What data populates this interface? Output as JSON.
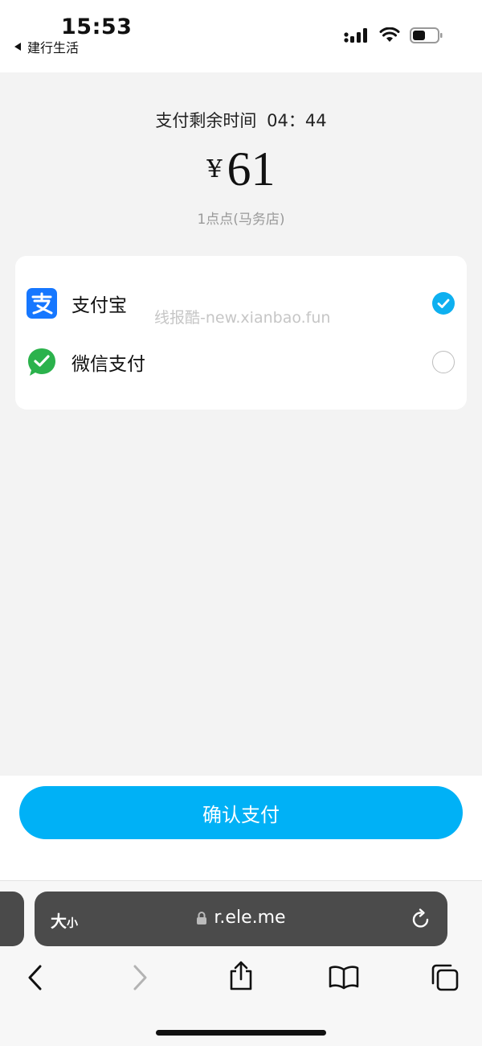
{
  "status_bar": {
    "time": "15:53",
    "back_app": "建行生活"
  },
  "payment": {
    "countdown_label": "支付剩余时间",
    "countdown_value": "04：44",
    "currency": "¥",
    "amount": "61",
    "merchant": "1点点(马务店)"
  },
  "methods": [
    {
      "label": "支付宝",
      "icon": "alipay-icon",
      "selected": true
    },
    {
      "label": "微信支付",
      "icon": "wechat-pay-icon",
      "selected": false
    }
  ],
  "watermark": "线报酷-new.xianbao.fun",
  "confirm_label": "确认支付",
  "browser": {
    "text_size_big": "大",
    "text_size_small": "小",
    "url": "r.ele.me"
  },
  "colors": {
    "accent": "#00b1f6",
    "alipay_blue": "#1677ff",
    "wechat_green": "#2bb24c"
  }
}
